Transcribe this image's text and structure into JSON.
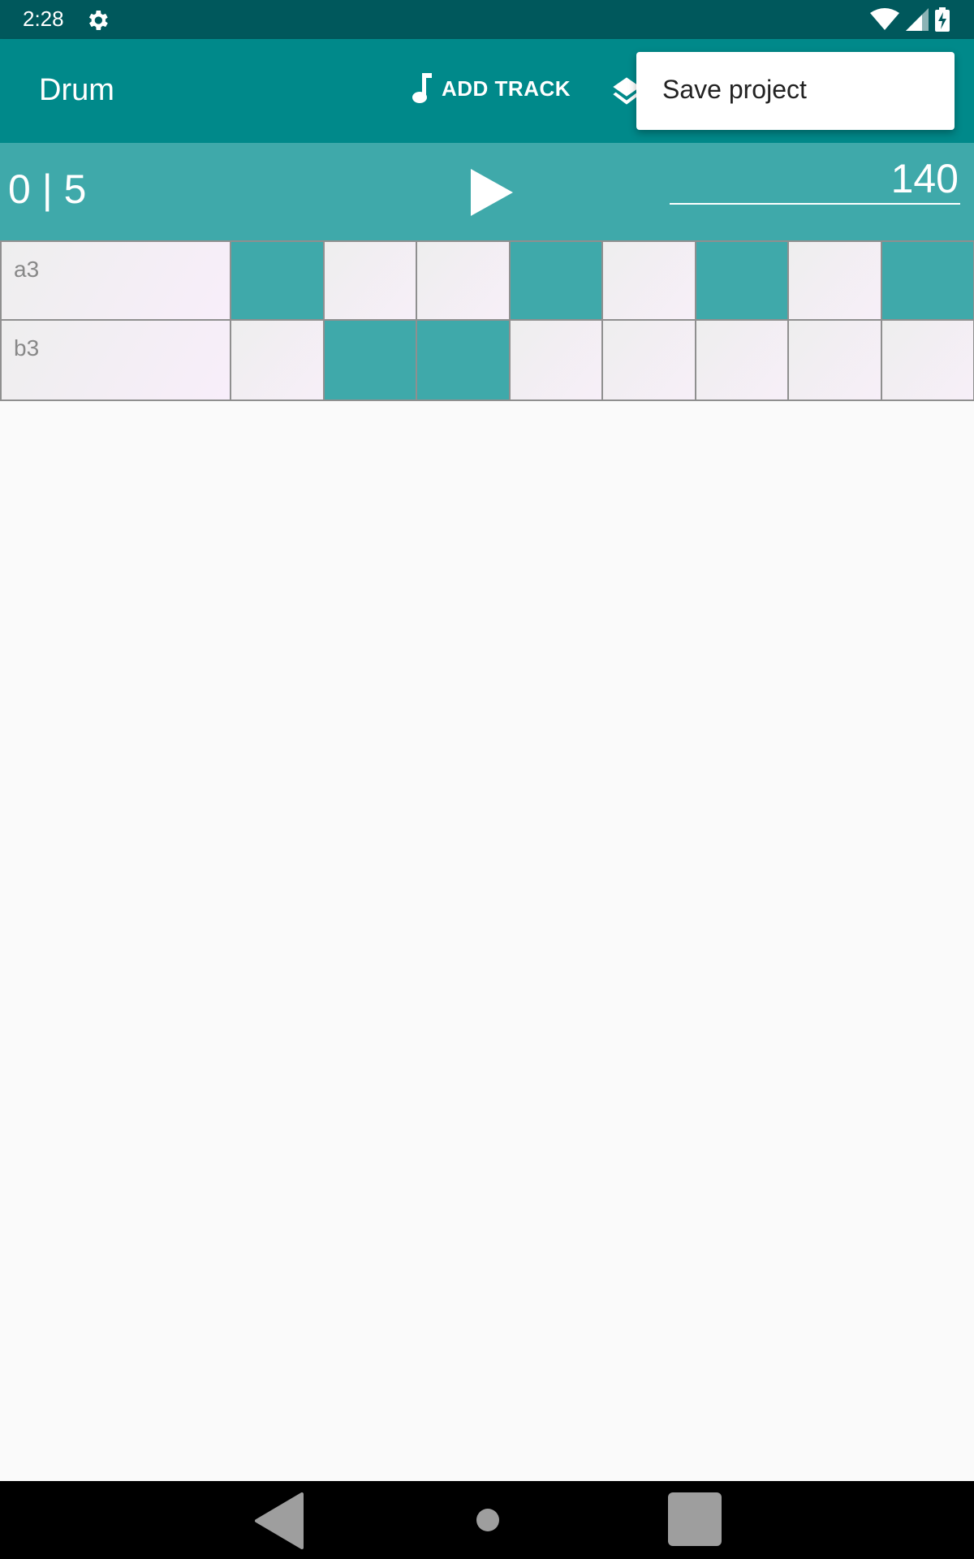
{
  "status_bar": {
    "time": "2:28"
  },
  "app_bar": {
    "title": "Drum",
    "add_track_label": "ADD TRACK"
  },
  "transport": {
    "position_counter": "0 | 5",
    "bpm_value": "140"
  },
  "tracks": [
    {
      "name": "a3",
      "steps": [
        true,
        false,
        false,
        true,
        false,
        true,
        false,
        true
      ]
    },
    {
      "name": "b3",
      "steps": [
        false,
        true,
        true,
        false,
        false,
        false,
        false,
        false
      ]
    }
  ],
  "overflow_menu": {
    "items": [
      "Save project"
    ]
  },
  "colors": {
    "status_bar": "#00585c",
    "app_bar": "#00898a",
    "transport_bar": "#3fa9aa",
    "active_step": "#3fa9aa"
  }
}
